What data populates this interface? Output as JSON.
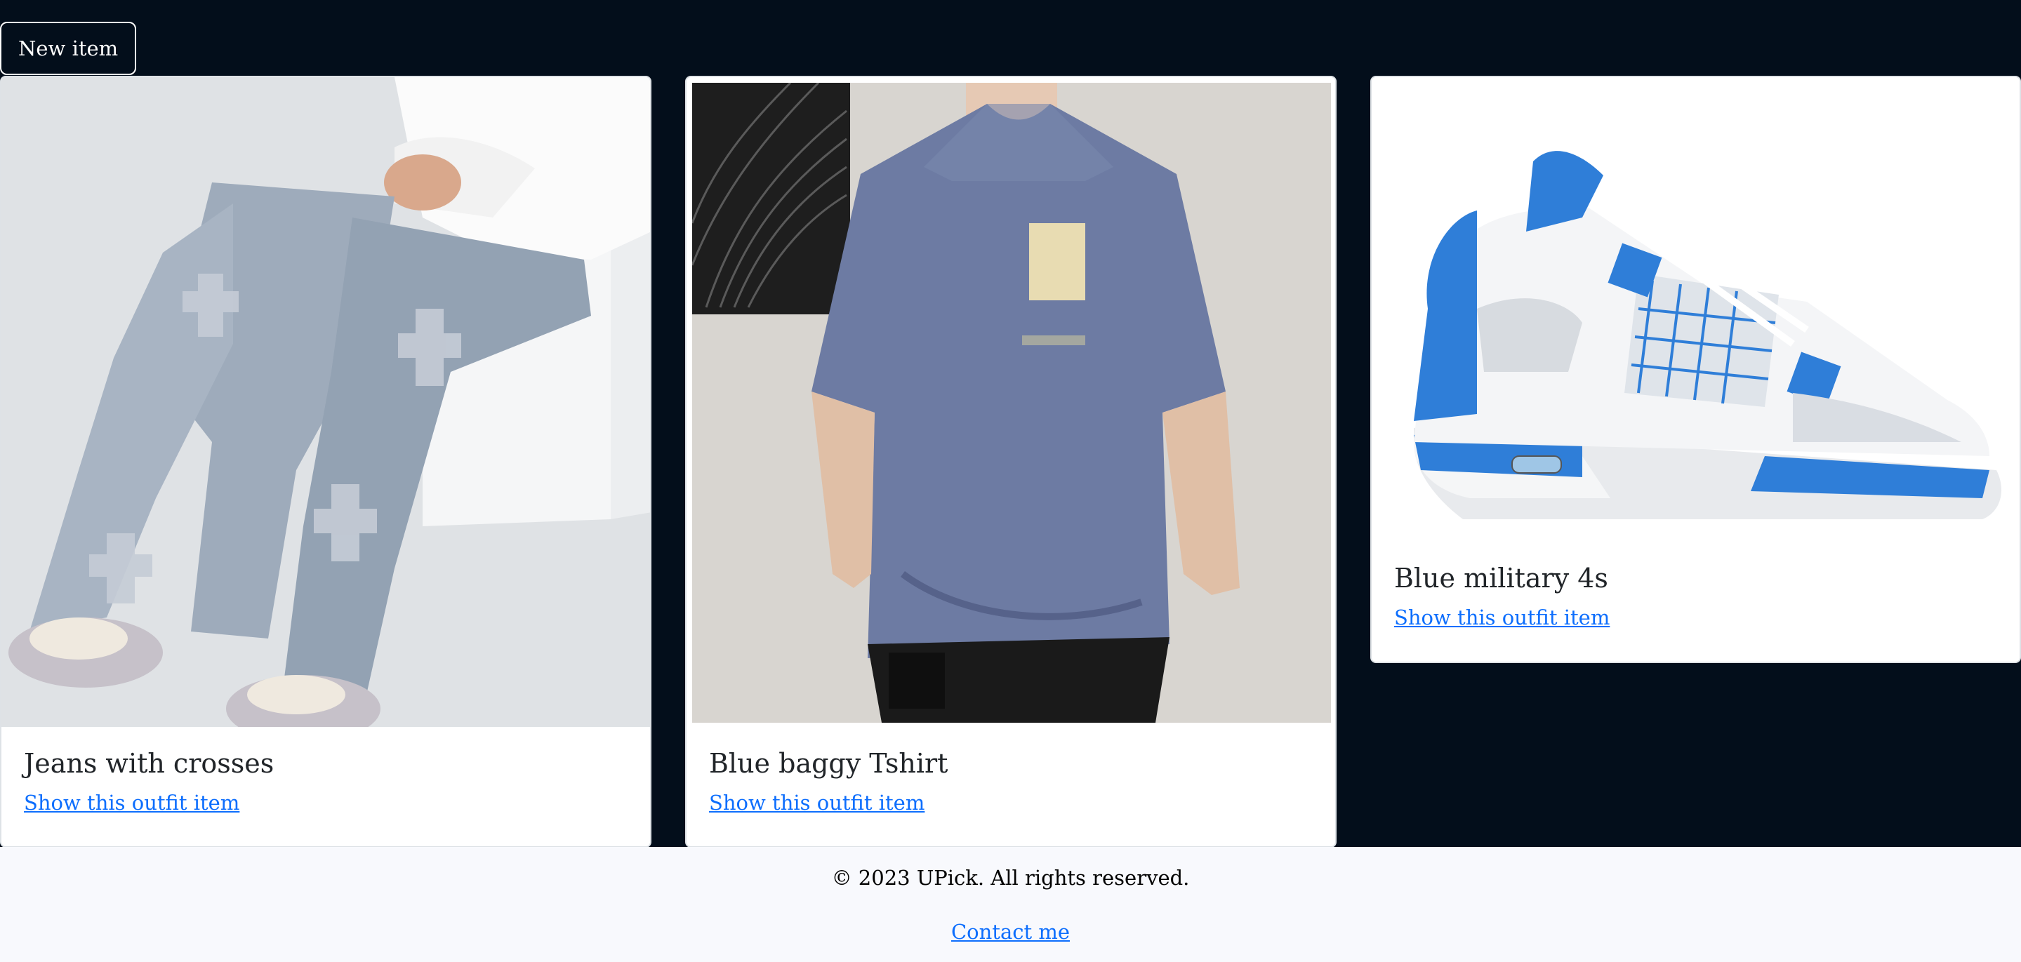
{
  "toolbar": {
    "new_item_label": "New item"
  },
  "cards": [
    {
      "title": "Jeans with crosses",
      "link": "Show this outfit item",
      "image_icon": "jeans-photo"
    },
    {
      "title": "Blue baggy Tshirt",
      "link": "Show this outfit item",
      "image_icon": "tshirt-photo"
    },
    {
      "title": "Blue military 4s",
      "link": "Show this outfit item",
      "image_icon": "sneaker-photo"
    }
  ],
  "footer": {
    "copyright": "© 2023 UPick. All rights reserved.",
    "contact": "Contact me"
  },
  "colors": {
    "background": "#030e1b",
    "card": "#ffffff",
    "link": "#0d6efd",
    "footer_bg": "#f8f9fd",
    "sneaker_accent": "#2f7ed8"
  }
}
